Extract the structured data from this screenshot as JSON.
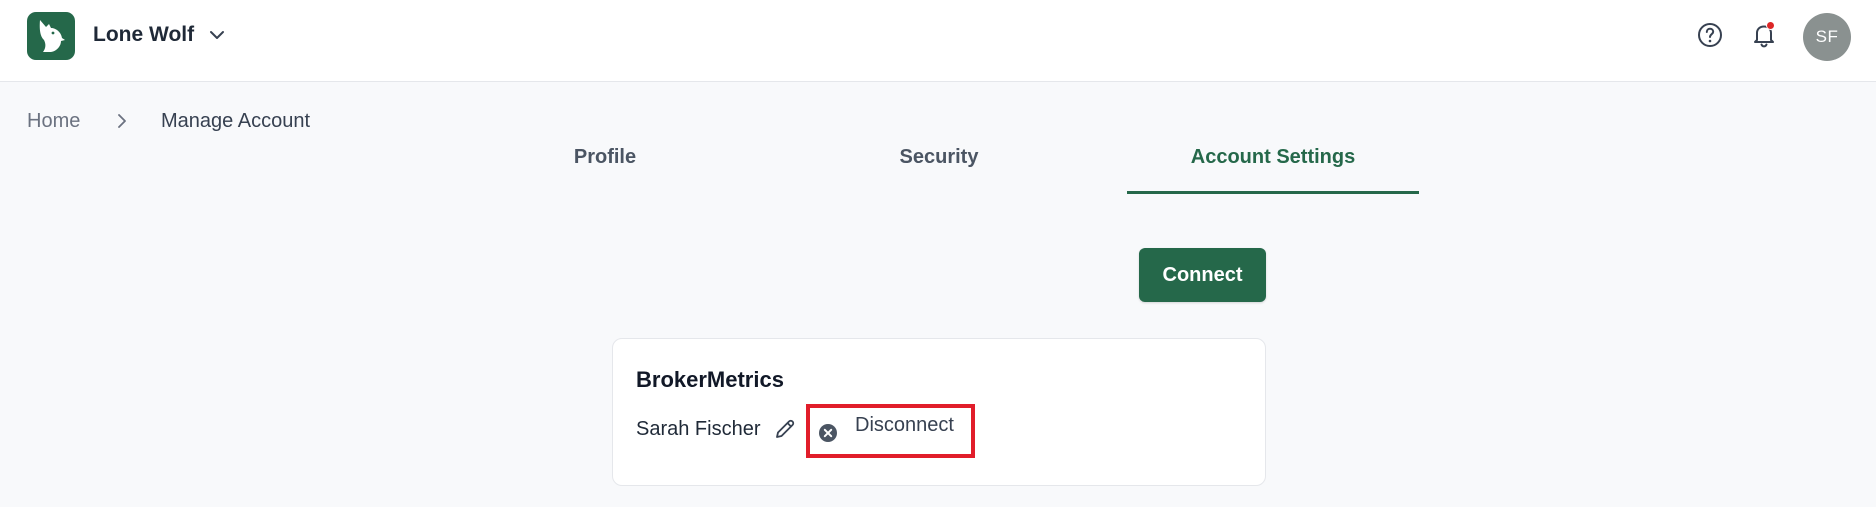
{
  "app": {
    "brand_name": "Lone Wolf",
    "logo_icon": "wolf-logo-icon",
    "brand_color": "#25684a"
  },
  "header": {
    "help_icon": "question-circle-icon",
    "notifications_icon": "bell-icon",
    "notification_dot_color": "#dc2626",
    "avatar_initials": "SF"
  },
  "breadcrumb": {
    "home": "Home",
    "current": "Manage Account"
  },
  "tabs": [
    {
      "label": "Profile",
      "active": false
    },
    {
      "label": "Security",
      "active": false
    },
    {
      "label": "Account Settings",
      "active": true
    }
  ],
  "actions": {
    "connect_label": "Connect"
  },
  "integration_card": {
    "title": "BrokerMetrics",
    "user_name": "Sarah Fischer",
    "edit_icon": "pencil-icon",
    "disconnect_icon": "x-circle-icon",
    "disconnect_label": "Disconnect",
    "highlight_color": "#e11d2a"
  }
}
